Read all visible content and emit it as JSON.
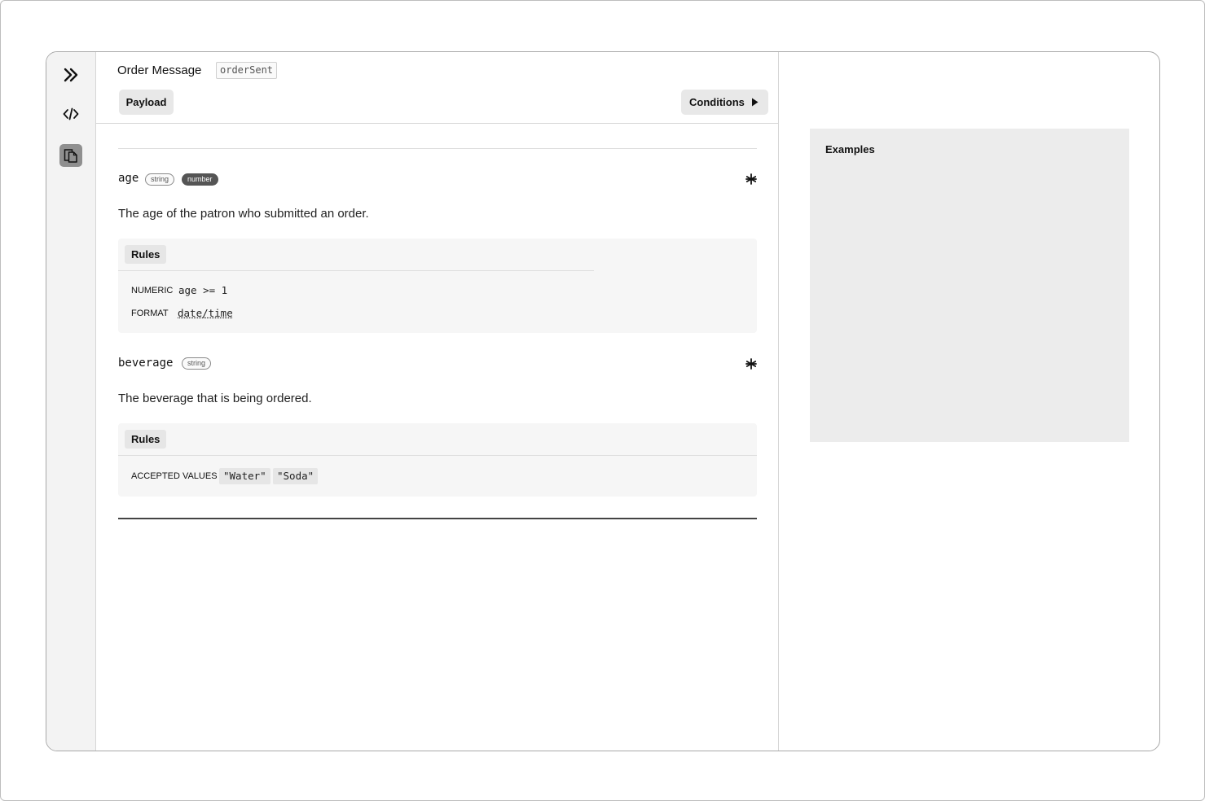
{
  "message": {
    "title": "Order Message",
    "id": "orderSent"
  },
  "tabs": {
    "payload": "Payload",
    "conditions": "Conditions"
  },
  "sidebar": {
    "items": [
      {
        "icon": "chevrons-right-icon"
      },
      {
        "icon": "code-icon"
      },
      {
        "icon": "documents-icon",
        "active": true
      }
    ]
  },
  "properties": [
    {
      "name": "age",
      "types": [
        "string",
        "number"
      ],
      "required": true,
      "description": "The age of the patron who submitted an order.",
      "rules_label": "Rules",
      "rules": [
        {
          "key": "NUMERIC",
          "value": "age >= 1"
        },
        {
          "key": "FORMAT",
          "value": "date/time"
        }
      ]
    },
    {
      "name": "beverage",
      "types": [
        "string"
      ],
      "required": true,
      "description": "The beverage that is being ordered.",
      "rules_label": "Rules",
      "rules": [
        {
          "key": "ACCEPTED VALUES",
          "values": [
            "\"Water\"",
            "\"Soda\""
          ]
        }
      ]
    }
  ],
  "examples": {
    "title": "Examples"
  }
}
